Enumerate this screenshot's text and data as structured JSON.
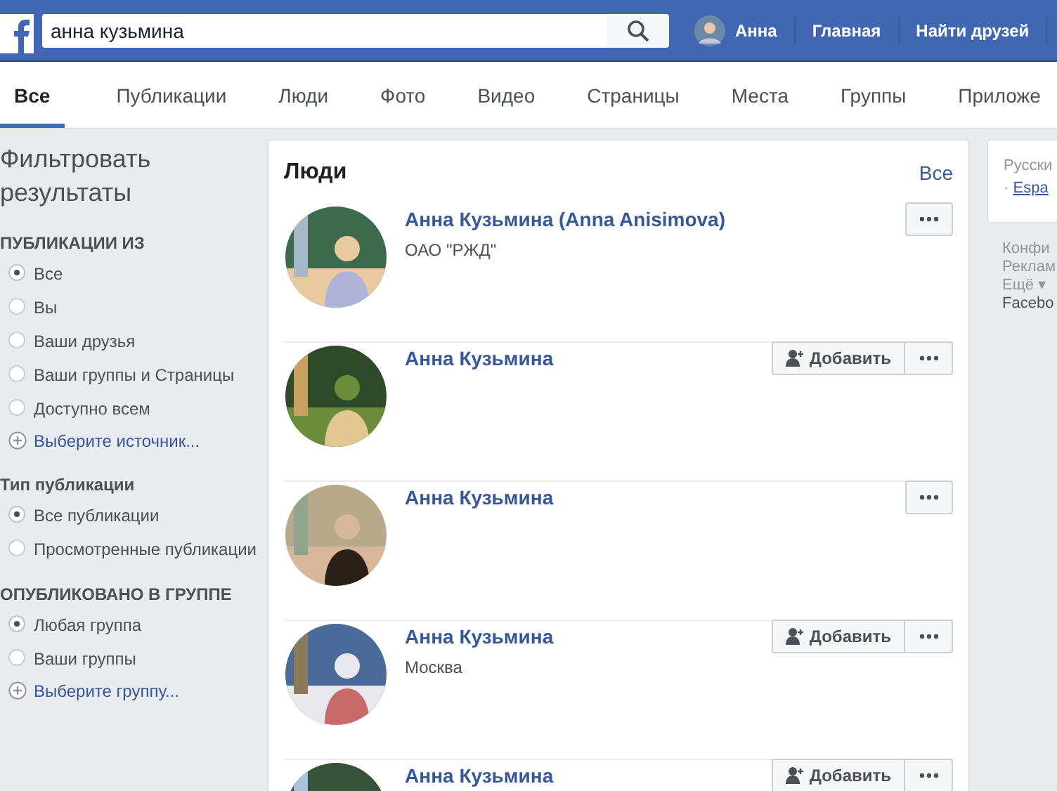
{
  "topbar": {
    "search": {
      "value": "анна кузьмина"
    },
    "user": "Анна",
    "links": [
      "Главная",
      "Найти друзей"
    ]
  },
  "tabs": [
    {
      "label": "Все",
      "selected": true
    },
    {
      "label": "Публикации",
      "selected": false
    },
    {
      "label": "Люди",
      "selected": false
    },
    {
      "label": "Фото",
      "selected": false
    },
    {
      "label": "Видео",
      "selected": false
    },
    {
      "label": "Страницы",
      "selected": false
    },
    {
      "label": "Места",
      "selected": false
    },
    {
      "label": "Группы",
      "selected": false
    },
    {
      "label": "Приложе",
      "selected": false
    }
  ],
  "filters": {
    "title": "Фильтровать результаты",
    "sections": [
      {
        "heading": "ПУБЛИКАЦИИ ИЗ",
        "options": [
          {
            "label": "Все",
            "selected": true
          },
          {
            "label": "Вы",
            "selected": false
          },
          {
            "label": "Ваши друзья",
            "selected": false
          },
          {
            "label": "Ваши группы и Страницы",
            "selected": false
          },
          {
            "label": "Доступно всем",
            "selected": false
          }
        ],
        "add_link": "Выберите источник..."
      },
      {
        "heading": "Тип публикации",
        "options": [
          {
            "label": "Все публикации",
            "selected": true
          },
          {
            "label": "Просмотренные публикации",
            "selected": false
          }
        ]
      },
      {
        "heading": "ОПУБЛИКОВАНО В ГРУППЕ",
        "options": [
          {
            "label": "Любая группа",
            "selected": true
          },
          {
            "label": "Ваши группы",
            "selected": false
          }
        ],
        "add_link": "Выберите группу..."
      }
    ]
  },
  "people": {
    "title": "Люди",
    "see_all": "Все",
    "results": [
      {
        "name": "Анна Кузьмина (Anna Anisimova)",
        "subtitle": "ОАО \"РЖД\""
      },
      {
        "name": "Анна Кузьмина",
        "add_button": "Добавить"
      },
      {
        "name": "Анна Кузьмина"
      },
      {
        "name": "Анна Кузьмина",
        "subtitle": "Москва",
        "add_button": "Добавить"
      },
      {
        "name": "Анна Кузьмина",
        "add_button": "Добавить"
      }
    ]
  },
  "right": {
    "languages": [
      "Русски",
      "Espa"
    ],
    "separator": "·",
    "footer_links": [
      "Конфи",
      "Реклам",
      "Ещё ▾",
      "Facebo"
    ]
  }
}
